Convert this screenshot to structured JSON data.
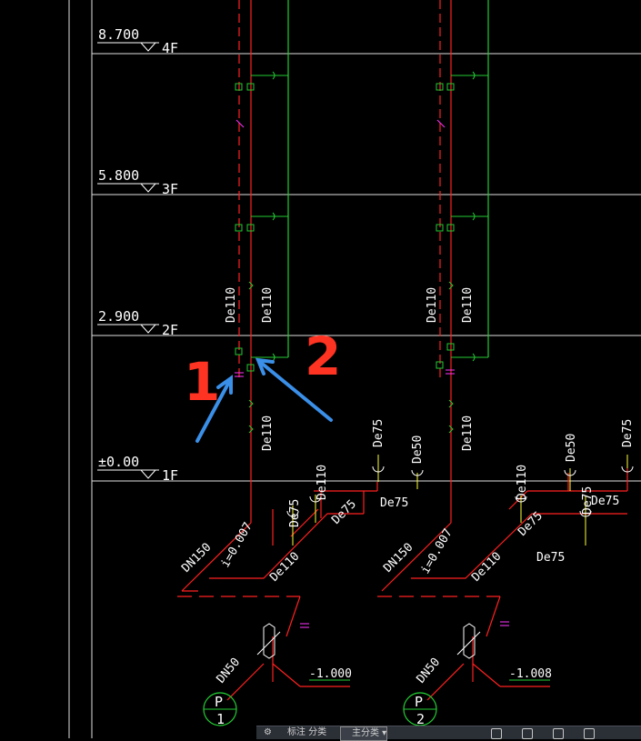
{
  "levels": [
    {
      "elevation": "8.700",
      "floor": "4F"
    },
    {
      "elevation": "5.800",
      "floor": "3F"
    },
    {
      "elevation": "2.900",
      "floor": "2F"
    },
    {
      "elevation": "±0.00",
      "floor": "1F"
    }
  ],
  "pipe_labels": {
    "de110": "De110",
    "de75": "De75",
    "de50": "De50",
    "dn150": "DN150",
    "dn50": "DN50",
    "slope": "i=0.007"
  },
  "outlet_levels": [
    "-1.000",
    "-1.008"
  ],
  "pumps": [
    {
      "letter": "P",
      "num": "1"
    },
    {
      "letter": "P",
      "num": "2"
    }
  ],
  "annotations": {
    "note1": "1",
    "note2": "2"
  },
  "toolbar": {
    "item1": "标注 分类",
    "item2": "主分类"
  },
  "colors": {
    "background": "#000000",
    "red_pipe": "#ff2020",
    "green_pipe": "#22cc33",
    "level_line": "#e0e0e0",
    "magenta": "#ff33ff",
    "yellow": "#ffff33",
    "arrow": "#3a8fe8",
    "handwriting": "#ff3322"
  }
}
